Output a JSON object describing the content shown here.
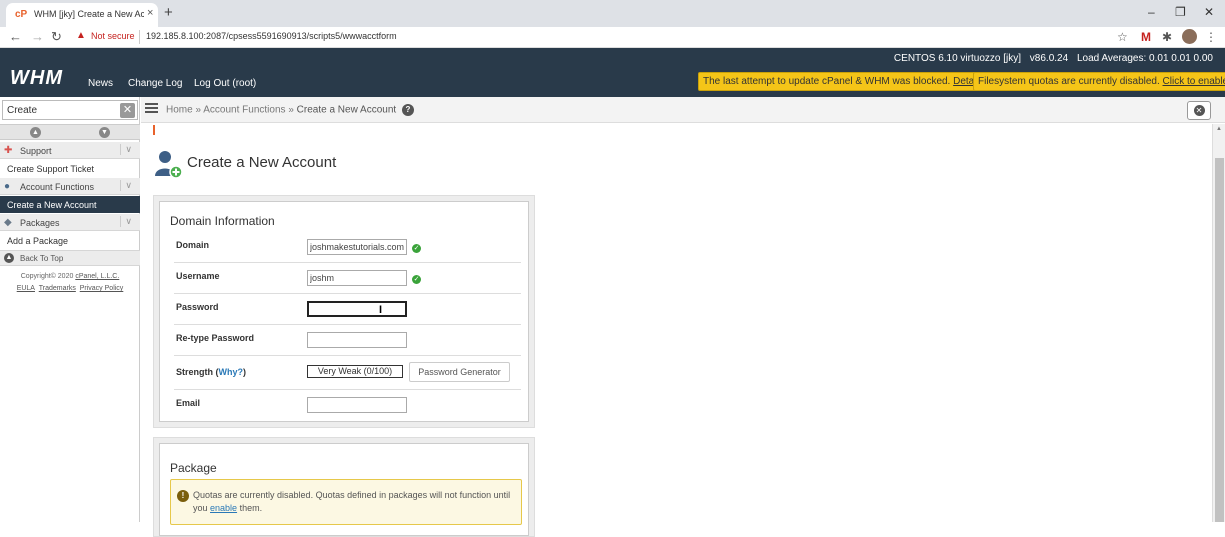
{
  "browser": {
    "tab_title": "WHM [jky] Create a New Account",
    "tab_close": "×",
    "new_tab": "+",
    "not_secure": "Not secure",
    "url": "192.185.8.100:2087/cpsess5591690913/scripts5/wwwacctform",
    "window_controls": [
      "–",
      "❐",
      "✕"
    ]
  },
  "header": {
    "logo": "WHM",
    "nav": [
      "News",
      "Change Log",
      "Log Out (root)"
    ],
    "server": "CENTOS 6.10 virtuozzo [jky]",
    "version": "v86.0.24",
    "load": "Load Averages: 0.01 0.01 0.00",
    "alert_update": "The last attempt to update cPanel & WHM was blocked.",
    "alert_update_link": "Details",
    "alert_quota": "Filesystem quotas are currently disabled.",
    "alert_quota_link": "Click to enable."
  },
  "sidebar": {
    "search_value": "Create",
    "categories": [
      {
        "label": "Support",
        "items": [
          "Create Support Ticket"
        ]
      },
      {
        "label": "Account Functions",
        "items": [
          "Create a New Account"
        ]
      },
      {
        "label": "Packages",
        "items": [
          "Add a Package"
        ]
      }
    ],
    "back_to_top": "Back To Top",
    "copyright": "Copyright© 2020",
    "copyright_link": "cPanel, L.L.C.",
    "links": [
      "EULA",
      "Trademarks",
      "Privacy Policy"
    ]
  },
  "breadcrumb": {
    "items": [
      "Home",
      "Account Functions",
      "Create a New Account"
    ],
    "separator": "»"
  },
  "page": {
    "title": "Create a New Account"
  },
  "domain_info": {
    "title": "Domain Information",
    "domain_label": "Domain",
    "domain_value": "joshmakestutorials.com",
    "username_label": "Username",
    "username_value": "joshm",
    "password_label": "Password",
    "password_value": "",
    "retype_label": "Re-type Password",
    "retype_value": "",
    "strength_label": "Strength (",
    "strength_why": "Why?",
    "strength_close": ")",
    "strength_value": "Very Weak (0/100)",
    "generator_button": "Password Generator",
    "email_label": "Email",
    "email_value": ""
  },
  "package": {
    "title": "Package",
    "alert_text_1": "Quotas are currently disabled. Quotas defined in packages will not function until you",
    "alert_link": "enable",
    "alert_text_2": "them."
  },
  "colors": {
    "header_bg": "#293a4a",
    "alert_yellow": "#f5c518",
    "link_blue": "#2a79b7",
    "check_green": "#3aa33a"
  }
}
